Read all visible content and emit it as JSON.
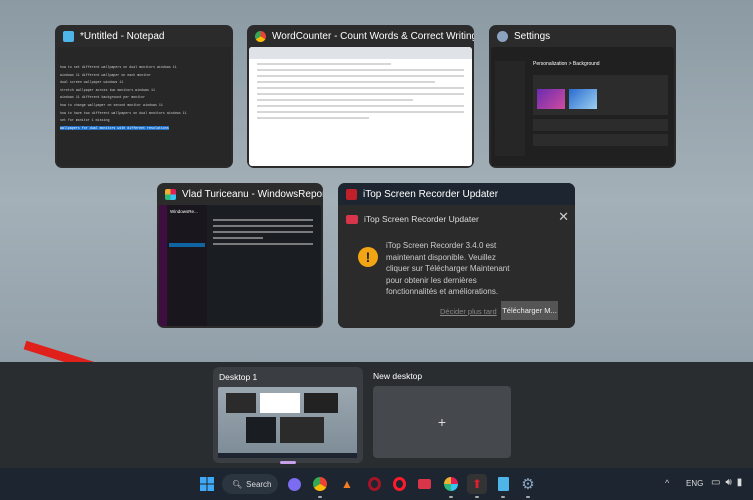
{
  "windows": [
    {
      "title": "*Untitled - Notepad",
      "icon": "notepad-icon",
      "lines": [
        "how to set different wallpapers on dual monitors windows 11",
        "windows 11 different wallpaper on each monitor",
        "dual screen wallpaper windows 11",
        "stretch wallpaper across two monitors windows 11",
        "windows 11 different background per monitor",
        "how to change wallpaper on second monitor windows 11",
        "how to have two different wallpapers on dual monitors windows 11",
        "set for monitor 1 missing"
      ],
      "selected_line": "wallpapers for dual monitors with different resolutions"
    },
    {
      "title": "WordCounter - Count Words & Correct Writing - Google Chr...",
      "icon": "chrome-icon"
    },
    {
      "title": "Settings",
      "icon": "settings-icon",
      "page": "Personalization > Background"
    },
    {
      "title": "Vlad Turiceanu - WindowsReport - Intern...",
      "icon": "slack-icon",
      "workspace": "WindowsRe..."
    },
    {
      "title": "iTop Screen Recorder Updater",
      "icon": "itop-updater-icon",
      "dialog_title": "iTop Screen Recorder Updater",
      "message": "iTop Screen Recorder 3.4.0 est maintenant disponible. Veuillez cliquer sur Télécharger Maintenant pour obtenir les dernières fonctionnalités et améliorations.",
      "later": "Décider plus tard",
      "download": "Télécharger M..."
    }
  ],
  "desktops": [
    {
      "label": "Desktop 1",
      "active": true
    },
    {
      "label": "New desktop",
      "add": "+"
    }
  ],
  "taskbar": {
    "search": "Search",
    "lang": "ENG",
    "chevron": "^"
  },
  "colors": {
    "arrow": "#e0201b",
    "accent": "#1e6fc7",
    "warning": "#f2a514"
  }
}
